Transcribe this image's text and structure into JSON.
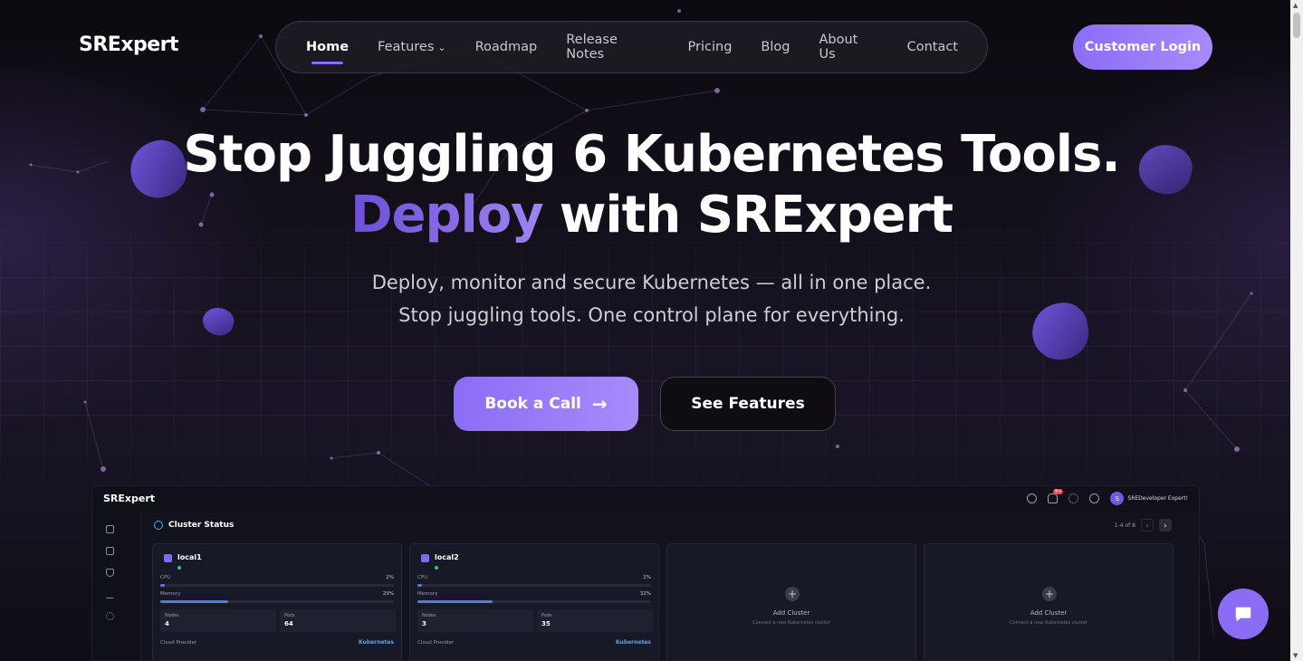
{
  "header": {
    "logo": "SRExpert",
    "nav": [
      {
        "label": "Home",
        "active": true
      },
      {
        "label": "Features",
        "dropdown": true
      },
      {
        "label": "Roadmap"
      },
      {
        "label": "Release Notes"
      },
      {
        "label": "Pricing"
      },
      {
        "label": "Blog"
      },
      {
        "label": "About Us"
      },
      {
        "label": "Contact"
      }
    ],
    "login_label": "Customer Login"
  },
  "hero": {
    "title_line1": "Stop Juggling 6 Kubernetes Tools.",
    "title_accent": "Deploy",
    "title_line2_rest": "with SRExpert",
    "subtitle_line1": "Deploy, monitor and secure Kubernetes — all in one place.",
    "subtitle_line2": "Stop juggling tools. One control plane for everything.",
    "primary_cta": "Book a Call",
    "secondary_cta": "See Features"
  },
  "dashboard": {
    "logo": "SRExpert",
    "notification_badge": "9+",
    "avatar_initial": "S",
    "user_name": "SREDeveloper Expert!",
    "section_title": "Cluster Status",
    "pagination": "1-4 of 8",
    "clusters": [
      {
        "name": "local1",
        "cpu_label": "CPU",
        "cpu": "2%",
        "cpu_value": 0.02,
        "mem_label": "Memory",
        "memory": "29%",
        "memory_value": 0.29,
        "nodes_label": "Nodes",
        "nodes": "4",
        "pods_label": "Pods",
        "pods": "64",
        "provider_label": "Cloud Provider",
        "provider": "Kubernetes"
      },
      {
        "name": "local2",
        "cpu_label": "CPU",
        "cpu": "2%",
        "cpu_value": 0.02,
        "mem_label": "Memory",
        "memory": "32%",
        "memory_value": 0.32,
        "nodes_label": "Nodes",
        "nodes": "3",
        "pods_label": "Pods",
        "pods": "35",
        "provider_label": "Cloud Provider",
        "provider": "Kubernetes"
      }
    ],
    "add_cards": [
      {
        "title": "Add Cluster",
        "subtitle": "Connect a new Kubernetes cluster"
      },
      {
        "title": "Add Cluster",
        "subtitle": "Connect a new Kubernetes cluster"
      }
    ]
  },
  "colors": {
    "accent": "#8b6df5",
    "background": "#0d0b12",
    "link": "#5aa7f0",
    "status_ok": "#37c871"
  },
  "icons": [
    "chevron-down-icon",
    "arrow-right-icon",
    "chat-icon",
    "bell-icon",
    "gear-icon",
    "help-icon",
    "globe-icon",
    "plus-icon"
  ]
}
